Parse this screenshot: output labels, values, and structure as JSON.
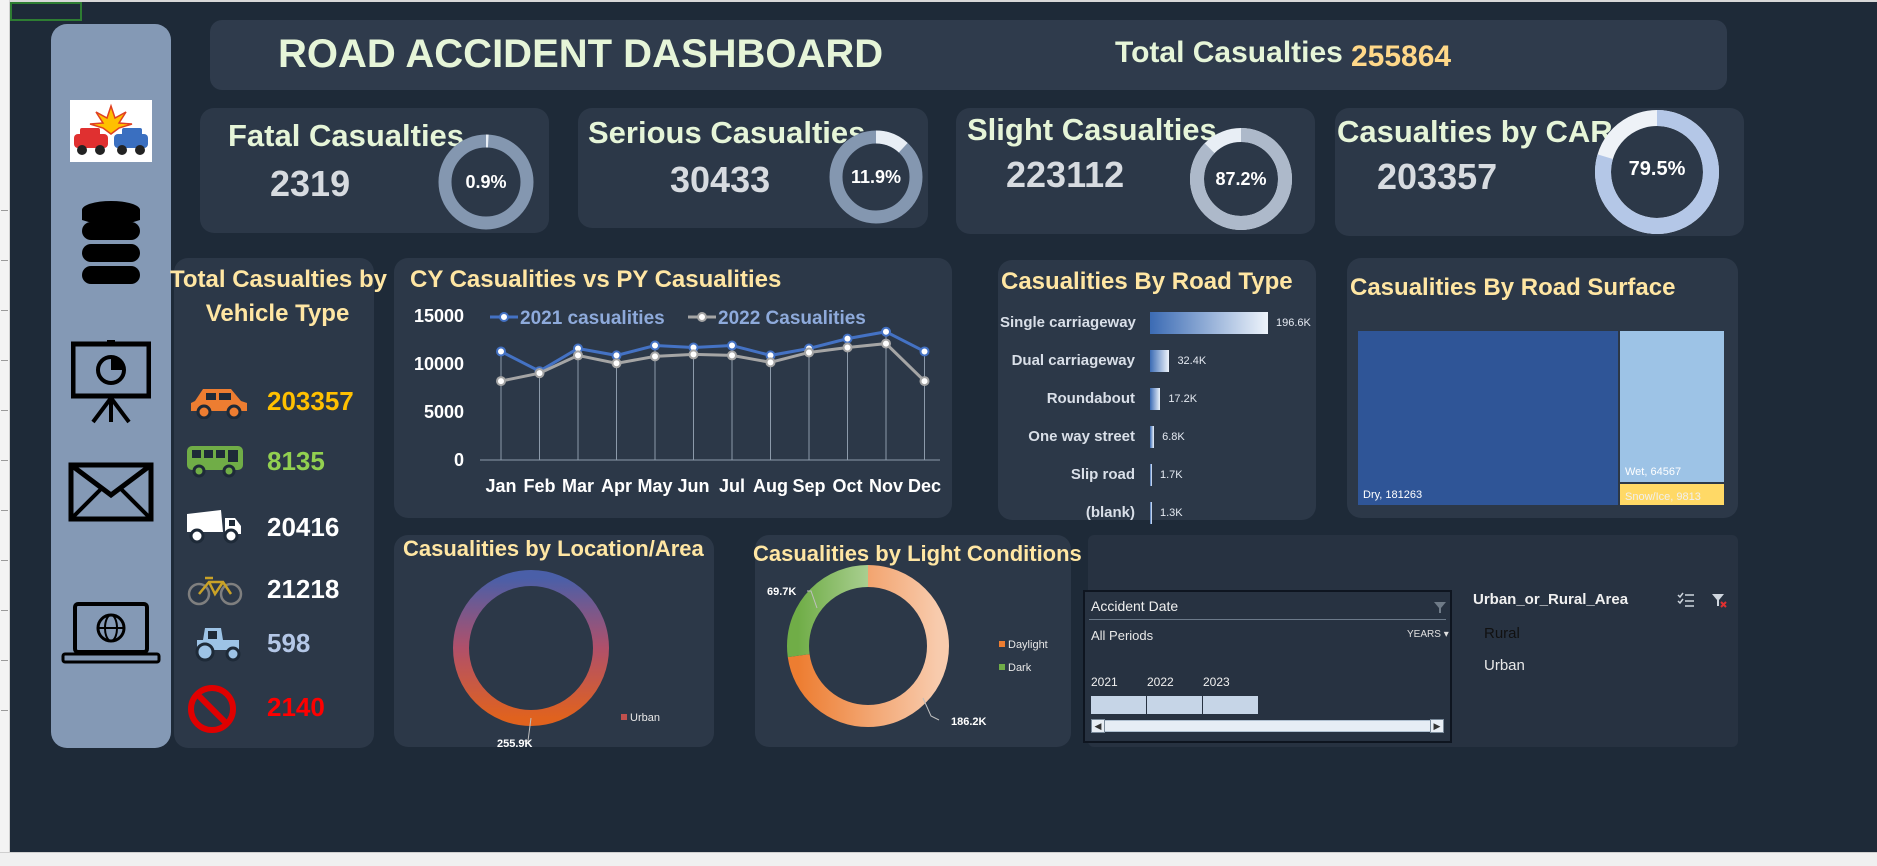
{
  "header": {
    "title": "ROAD ACCIDENT DASHBOARD",
    "total_label": "Total Casualties",
    "total_value": "255864"
  },
  "kpis": [
    {
      "label": "Fatal Casualties",
      "value": "2319",
      "pct_label": "0.9%",
      "pct": 0.009
    },
    {
      "label": "Serious Casualties",
      "value": "30433",
      "pct_label": "11.9%",
      "pct": 0.119
    },
    {
      "label": "Slight Casualties",
      "value": "223112",
      "pct_label": "87.2%",
      "pct": 0.872
    },
    {
      "label": "Casualties by CAR",
      "value": "203357",
      "pct_label": "79.5%",
      "pct": 0.795
    }
  ],
  "sidebar_icons": [
    "car-crash-icon",
    "database-icon",
    "presentation-icon",
    "mail-icon",
    "laptop-globe-icon"
  ],
  "vehicle_section": {
    "title_line1": "Total Casualties by",
    "title_line2": "Vehicle Type",
    "items": [
      {
        "icon": "car-icon",
        "value": "203357",
        "color": "#ffc000"
      },
      {
        "icon": "bus-icon",
        "value": "8135",
        "color": "#92d050"
      },
      {
        "icon": "truck-icon",
        "value": "20416",
        "color": "#ffffff"
      },
      {
        "icon": "bicycle-icon",
        "value": "21218",
        "color": "#ffffff"
      },
      {
        "icon": "tractor-icon",
        "value": "598",
        "color": "#b4c7e7"
      },
      {
        "icon": "no-entry-icon",
        "value": "2140",
        "color": "#ff0000"
      }
    ]
  },
  "chart_data": [
    {
      "type": "line",
      "title": "CY Casualities vs PY Casualities",
      "categories": [
        "Jan",
        "Feb",
        "Mar",
        "Apr",
        "May",
        "Jun",
        "Jul",
        "Aug",
        "Sep",
        "Oct",
        "Nov",
        "Dec"
      ],
      "series": [
        {
          "name": "2021 casualities",
          "color": "#4472c4",
          "values": [
            11000,
            9000,
            11300,
            10600,
            11600,
            11400,
            11600,
            10600,
            11300,
            12300,
            13000,
            11000
          ]
        },
        {
          "name": "2022 Casualities",
          "color": "#a5a5a5",
          "values": [
            8000,
            8800,
            10600,
            9800,
            10500,
            10700,
            10600,
            9900,
            10900,
            11400,
            11800,
            8000
          ]
        }
      ],
      "yticks": [
        "15000",
        "10000",
        "5000",
        "0"
      ],
      "ylim": [
        0,
        15000
      ],
      "legend": "top"
    },
    {
      "type": "bar",
      "title": "Casualities By Road Type",
      "categories": [
        "Single carriageway",
        "Dual carriageway",
        "Roundabout",
        "One way street",
        "Slip road",
        "(blank)"
      ],
      "values": [
        196.6,
        32.4,
        17.2,
        6.8,
        1.7,
        1.3
      ],
      "value_labels": [
        "196.6K",
        "32.4K",
        "17.2K",
        "6.8K",
        "1.7K",
        "1.3K"
      ]
    },
    {
      "type": "treemap",
      "title": "Casualities By Road Surface",
      "items": [
        {
          "label": "Dry, 181263",
          "value": 181263,
          "color": "#2f5597"
        },
        {
          "label": "Wet, 64567",
          "value": 64567,
          "color": "#9dc3e6"
        },
        {
          "label": "Snow/Ice, 9813",
          "value": 9813,
          "color": "#ffd966"
        }
      ]
    },
    {
      "type": "pie",
      "title": "Casualities by Location/Area",
      "slices": [
        {
          "name": "Urban",
          "value": 255.9,
          "label": "255.9K"
        }
      ],
      "legend": [
        "Urban"
      ]
    },
    {
      "type": "pie",
      "title": "Casualities by Light Conditions",
      "slices": [
        {
          "name": "Daylight",
          "value": 186.2,
          "label": "186.2K",
          "color": "#ed7d31"
        },
        {
          "name": "Dark",
          "value": 69.7,
          "label": "69.7K",
          "color": "#70ad47"
        }
      ],
      "legend": [
        "Daylight",
        "Dark"
      ]
    }
  ],
  "date_slicer": {
    "title": "Accident Date",
    "selection": "All Periods",
    "level": "YEARS",
    "years": [
      "2021",
      "2022",
      "2023"
    ]
  },
  "area_slicer": {
    "title": "Urban_or_Rural_Area",
    "items": [
      "Rural",
      "Urban"
    ]
  }
}
